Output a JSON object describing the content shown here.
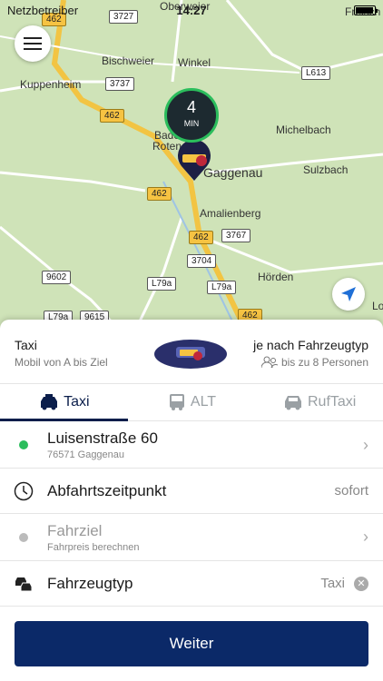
{
  "status": {
    "carrier": "Netzbetreiber",
    "time": "14:27"
  },
  "map": {
    "places": [
      "Oberweier",
      "Freisch",
      "Bischweier",
      "Winkel",
      "Kuppenheim",
      "Michelbach",
      "Baden",
      "Roten",
      "Gaggenau",
      "Sulzbach",
      "Amalienberg",
      "Hörden",
      "Lo"
    ],
    "roads": [
      "462",
      "3727",
      "3737",
      "462",
      "L613",
      "462",
      "3767",
      "462",
      "3704",
      "9602",
      "L79a",
      "L79a",
      "L79a",
      "9615",
      "462"
    ],
    "eta": {
      "value": "4",
      "unit": "MIN"
    }
  },
  "service": {
    "title": "Taxi",
    "subtitle": "Mobil von A bis Ziel",
    "price": "je nach Fahrzeugtyp",
    "capacity": "bis zu 8 Personen"
  },
  "tabs": [
    {
      "label": "Taxi",
      "icon": "taxi-icon",
      "active": true
    },
    {
      "label": "ALT",
      "icon": "bus-icon",
      "active": false
    },
    {
      "label": "RufTaxi",
      "icon": "car-icon",
      "active": false
    }
  ],
  "origin": {
    "street": "Luisenstraße 60",
    "city": "76571 Gaggenau"
  },
  "departure": {
    "label": "Abfahrtszeitpunkt",
    "value": "sofort"
  },
  "destination": {
    "label": "Fahrziel",
    "hint": "Fahrpreis berechnen"
  },
  "vehicle": {
    "label": "Fahrzeugtyp",
    "value": "Taxi"
  },
  "next_label": "Weiter",
  "colors": {
    "brand": "#0b2968",
    "green": "#2bbd5c"
  }
}
